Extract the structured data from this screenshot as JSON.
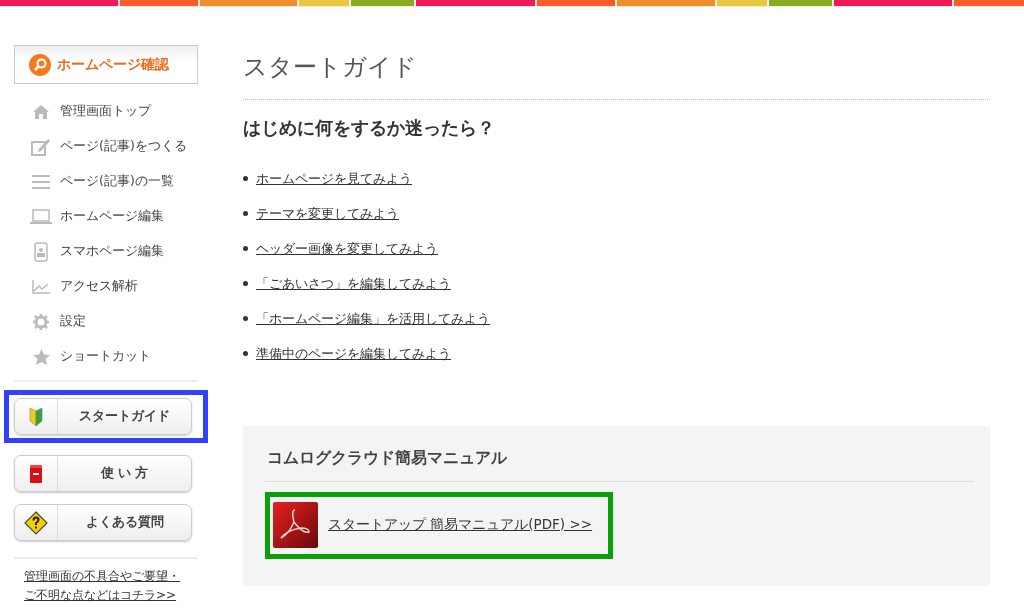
{
  "sidebar": {
    "preview_button": "ホームページ確認",
    "items": [
      {
        "label": "管理画面トップ",
        "kind": "home"
      },
      {
        "label": "ページ(記事)をつくる",
        "kind": "edit"
      },
      {
        "label": "ページ(記事)の一覧",
        "kind": "list"
      },
      {
        "label": "ホームページ編集",
        "kind": "pc"
      },
      {
        "label": "スマホページ編集",
        "kind": "phone"
      },
      {
        "label": "アクセス解析",
        "kind": "chart"
      },
      {
        "label": "設定",
        "kind": "gear"
      },
      {
        "label": "ショートカット",
        "kind": "star"
      }
    ],
    "buttons": [
      {
        "label": "スタートガイド",
        "kind": "beginner",
        "highlighted": true
      },
      {
        "label": "使 い 方",
        "kind": "book",
        "highlighted": false
      },
      {
        "label": "よくある質問",
        "kind": "question",
        "highlighted": false
      }
    ],
    "feedback_link": [
      "管理画面の不具合やご要望・",
      "ご不明な点などはコチラ>>"
    ]
  },
  "main": {
    "title": "スタートガイド",
    "heading": "はじめに何をするか迷ったら？",
    "links": [
      "ホームページを見てみよう",
      "テーマを変更してみよう",
      "ヘッダー画像を変更してみよう",
      "「ごあいさつ」を編集してみよう",
      "「ホームページ編集」を活用してみよう",
      "準備中のページを編集してみよう"
    ],
    "manual": {
      "heading": "コムログクラウド簡易マニュアル",
      "link": "スタートアップ 簡易マニュアル(PDF) >>",
      "highlighted": true
    }
  }
}
